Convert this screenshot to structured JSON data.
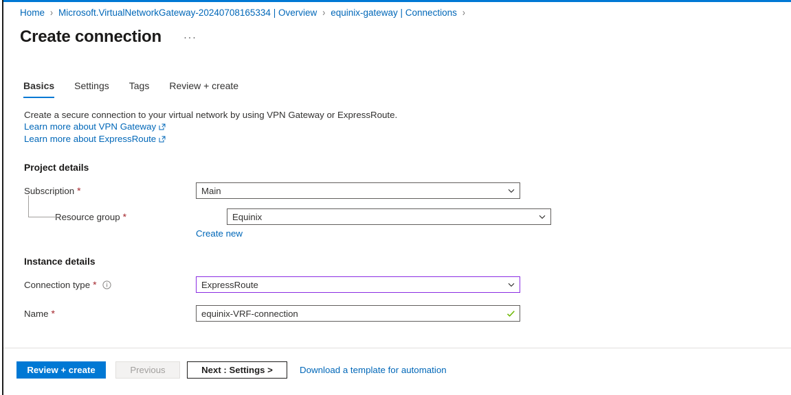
{
  "breadcrumb": {
    "items": [
      {
        "label": "Home"
      },
      {
        "label": "Microsoft.VirtualNetworkGateway-20240708165334 | Overview"
      },
      {
        "label": "equinix-gateway | Connections"
      }
    ],
    "separator": "›"
  },
  "header": {
    "title": "Create connection",
    "ellipsis": "···"
  },
  "tabs": [
    {
      "label": "Basics",
      "active": true
    },
    {
      "label": "Settings",
      "active": false
    },
    {
      "label": "Tags",
      "active": false
    },
    {
      "label": "Review + create",
      "active": false
    }
  ],
  "intro": {
    "description": "Create a secure connection to your virtual network by using VPN Gateway or ExpressRoute.",
    "links": [
      {
        "label": "Learn more about VPN Gateway",
        "icon": "external-link-icon"
      },
      {
        "label": "Learn more about ExpressRoute",
        "icon": "external-link-icon"
      }
    ]
  },
  "project_details": {
    "heading": "Project details",
    "subscription": {
      "label": "Subscription",
      "required": "*",
      "value": "Main",
      "control": "dropdown"
    },
    "resource_group": {
      "label": "Resource group",
      "required": "*",
      "value": "Equinix",
      "control": "dropdown",
      "create_new_label": "Create new"
    }
  },
  "instance_details": {
    "heading": "Instance details",
    "connection_type": {
      "label": "Connection type",
      "required": "*",
      "info_icon": "info-icon",
      "value": "ExpressRoute",
      "control": "dropdown",
      "state": "changed"
    },
    "name": {
      "label": "Name",
      "required": "*",
      "value": "equinix-VRF-connection",
      "placeholder": "",
      "control": "textbox",
      "state": "valid"
    }
  },
  "footer": {
    "review_create": "Review + create",
    "previous": "Previous",
    "next": "Next : Settings >",
    "download_template": "Download a template for automation"
  },
  "colors": {
    "accent": "#0078d4",
    "link": "#0067b8",
    "required": "#a4262c",
    "changed_border": "#8a2be2",
    "valid_check": "#6bb700"
  }
}
